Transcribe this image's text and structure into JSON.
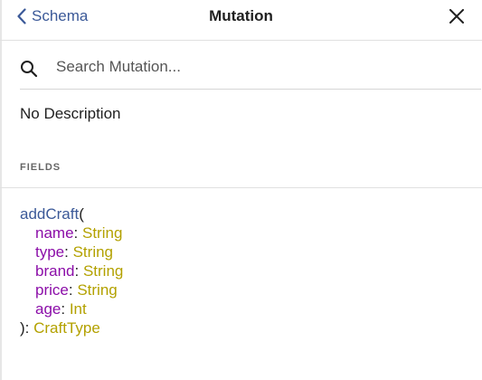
{
  "header": {
    "back_label": "Schema",
    "title": "Mutation"
  },
  "search": {
    "placeholder": "Search Mutation..."
  },
  "description": "No Description",
  "fields_section": {
    "label": "FIELDS"
  },
  "field": {
    "name": "addCraft",
    "open_paren": "(",
    "args": [
      {
        "name": "name",
        "type": "String"
      },
      {
        "name": "type",
        "type": "String"
      },
      {
        "name": "brand",
        "type": "String"
      },
      {
        "name": "price",
        "type": "String"
      },
      {
        "name": "age",
        "type": "Int"
      }
    ],
    "close": "): ",
    "return_type": "CraftType"
  },
  "colors": {
    "link": "#3b5998",
    "argument": "#8b0ea8",
    "type": "#b3a100"
  },
  "icons": {
    "back": "chevron-left-icon",
    "close": "close-icon",
    "search": "search-icon"
  }
}
